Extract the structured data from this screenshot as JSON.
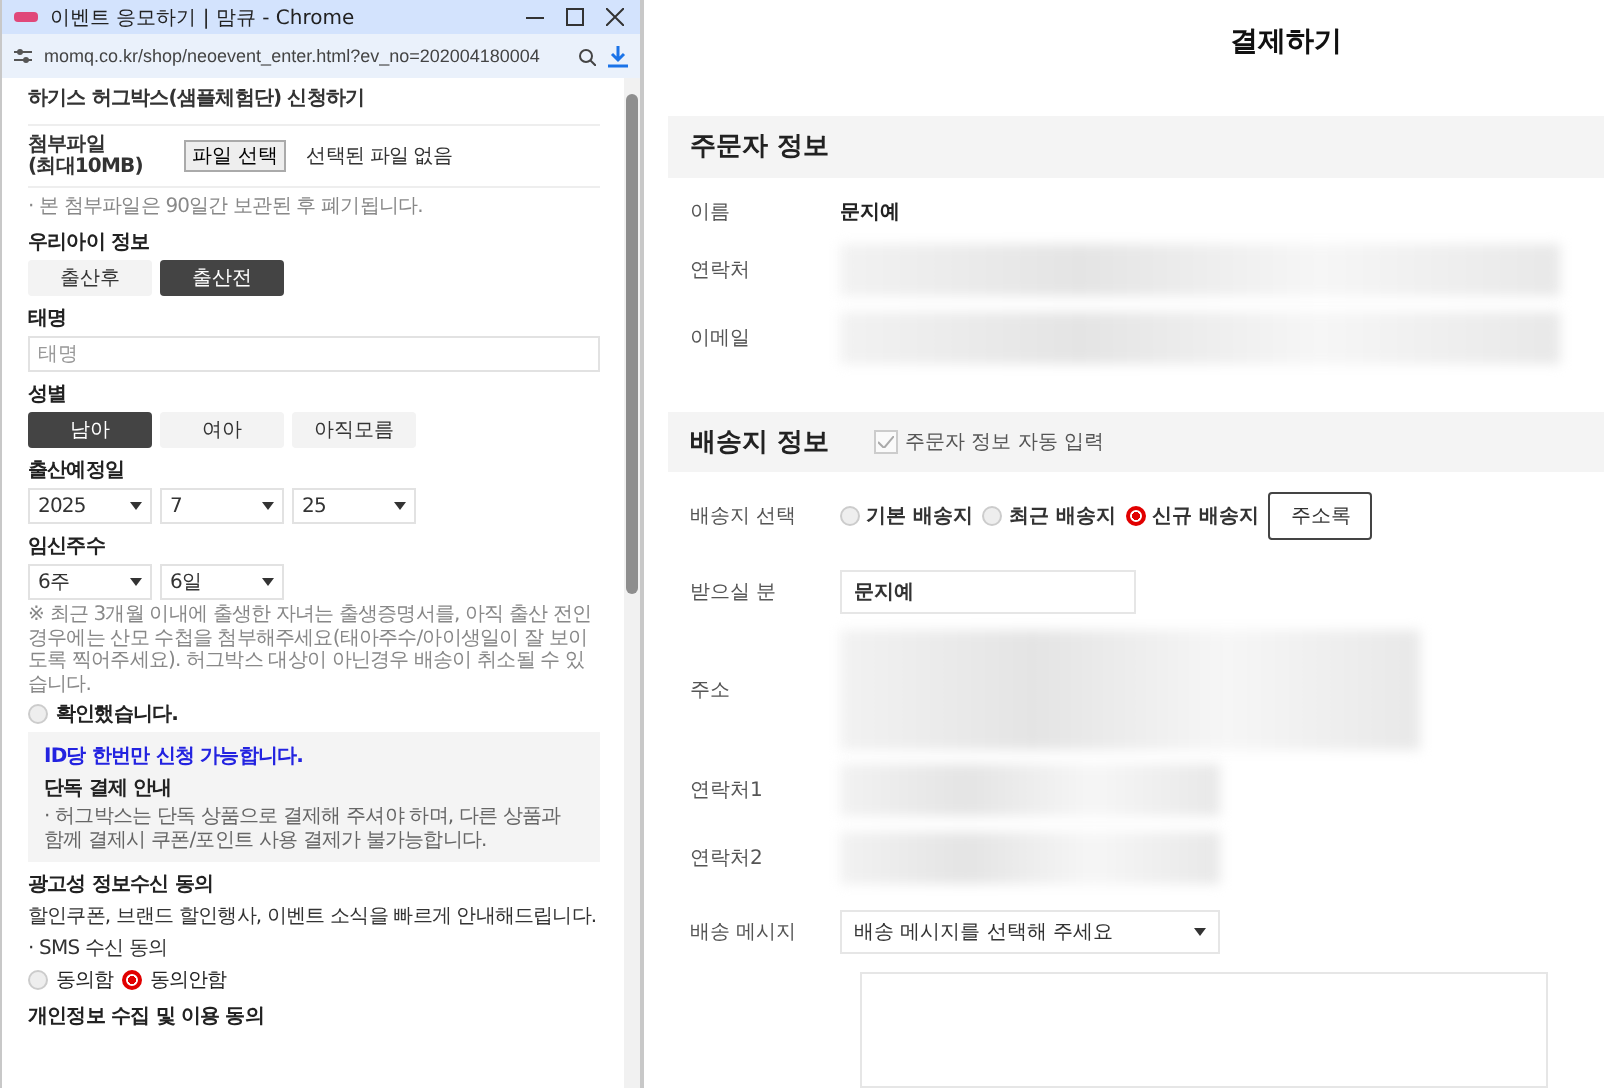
{
  "browser": {
    "title": "이벤트 응모하기 | 맘큐 - Chrome",
    "url": "momq.co.kr/shop/neoevent_enter.html?ev_no=202004180004"
  },
  "event_form": {
    "title": "하기스 허그박스(샘플체험단) 신청하기",
    "attachment": {
      "label": "첨부파일",
      "label_sub": "(최대10MB)",
      "button": "파일 선택",
      "status": "선택된 파일 없음",
      "note": "· 본 첨부파일은 90일간 보관된 후 폐기됩니다."
    },
    "child_info": {
      "heading": "우리아이 정보",
      "options": [
        {
          "label": "출산후",
          "selected": false
        },
        {
          "label": "출산전",
          "selected": true
        }
      ]
    },
    "nickname": {
      "heading": "태명",
      "placeholder": "태명"
    },
    "gender": {
      "heading": "성별",
      "options": [
        {
          "label": "남아",
          "selected": true
        },
        {
          "label": "여아",
          "selected": false
        },
        {
          "label": "아직모름",
          "selected": false
        }
      ]
    },
    "due_date": {
      "heading": "출산예정일",
      "selects": [
        "2025",
        "7",
        "25"
      ]
    },
    "pregnancy_weeks": {
      "heading": "임신주수",
      "selects": [
        "6주",
        "6일"
      ]
    },
    "notice": "※ 최근 3개월 이내에 출생한 자녀는 출생증명서를, 아직 출산 전인 경우에는 산모 수첩을 첨부해주세요(태아주수/아이생일이 잘 보이도록 찍어주세요). 허그박스 대상이 아닌경우 배송이 취소될 수 있습니다.",
    "confirm": {
      "label": "확인했습니다.",
      "checked": false
    },
    "info_box": {
      "highlight": "ID당 한번만 신청 가능합니다.",
      "heading": "단독 결제 안내",
      "text": "· 허그박스는 단독 상품으로 결제해 주셔야 하며, 다른 상품과 함께 결제시 쿠폰/포인트 사용 결제가 불가능합니다."
    },
    "marketing": {
      "heading": "광고성 정보수신 동의",
      "text": "할인쿠폰, 브랜드 할인행사, 이벤트 소식을 빠르게 안내해드립니다.",
      "sms_label": "· SMS 수신 동의",
      "options": [
        {
          "label": "동의함",
          "selected": false
        },
        {
          "label": "동의안함",
          "selected": true
        }
      ]
    },
    "privacy_heading": "개인정보 수집 및 이용 동의"
  },
  "checkout": {
    "title": "결제하기",
    "orderer": {
      "heading": "주문자 정보",
      "rows": [
        {
          "label": "이름",
          "value": "문지예",
          "kind": "text"
        },
        {
          "label": "연락처",
          "kind": "blurred"
        },
        {
          "label": "이메일",
          "kind": "blurred"
        }
      ]
    },
    "shipping": {
      "heading": "배송지 정보",
      "autofill": {
        "label": "주문자 정보 자동 입력",
        "checked": true
      },
      "address_choice": {
        "label": "배송지 선택",
        "options": [
          {
            "label": "기본 배송지",
            "selected": false
          },
          {
            "label": "최근 배송지",
            "selected": false
          },
          {
            "label": "신규 배송지",
            "selected": true
          }
        ],
        "button": "주소록"
      },
      "recipient": {
        "label": "받으실 분",
        "value": "문지예"
      },
      "address_label": "주소",
      "phone1_label": "연락처1",
      "phone2_label": "연락처2",
      "message": {
        "label": "배송 메시지",
        "select": "배송 메시지를 선택해 주세요"
      }
    }
  }
}
